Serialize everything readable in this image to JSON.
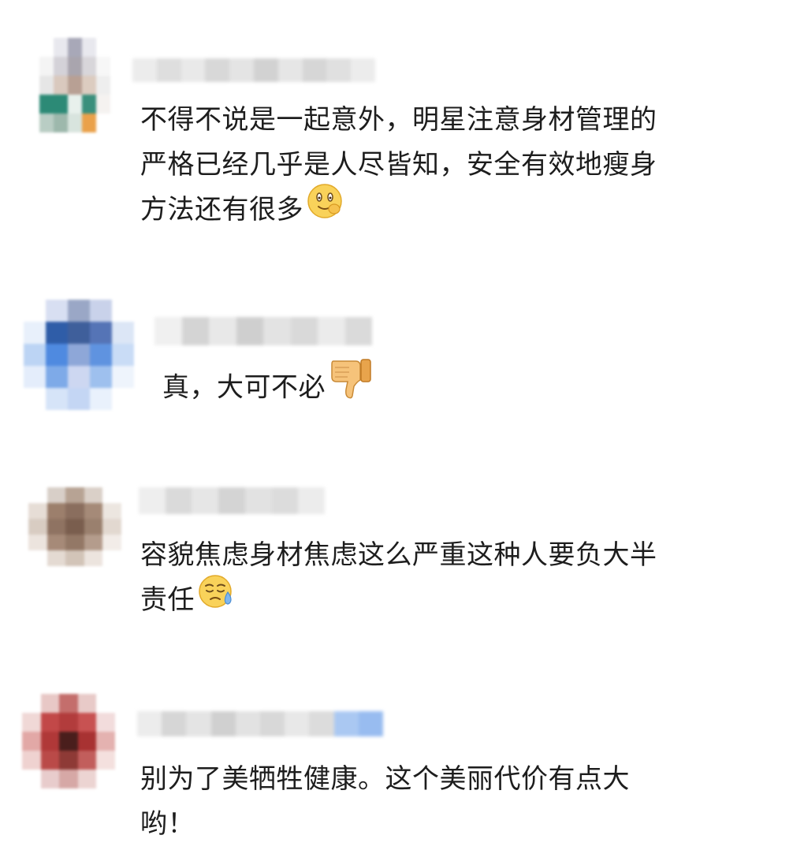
{
  "comments": [
    {
      "text_lines": [
        "不得不说是一起意外，明星注意身材管理的",
        "严格已经几乎是人尽皆知，安全有效地瘦身",
        "方法还有很多"
      ],
      "emoji": "smile-emoji"
    },
    {
      "text_lines": [
        "真，大可不必"
      ],
      "emoji": "thumbs-down-emoji"
    },
    {
      "text_lines": [
        "容貌焦虑身材焦虑这么严重这种人要负大半",
        "责任"
      ],
      "emoji": "sweat-emoji"
    },
    {
      "text_lines": [
        "别为了美牺牲健康。这个美丽代价有点大",
        "哟！"
      ],
      "emoji": ""
    }
  ],
  "colors": {
    "background": "#ffffff",
    "text": "#1d1d1d"
  }
}
